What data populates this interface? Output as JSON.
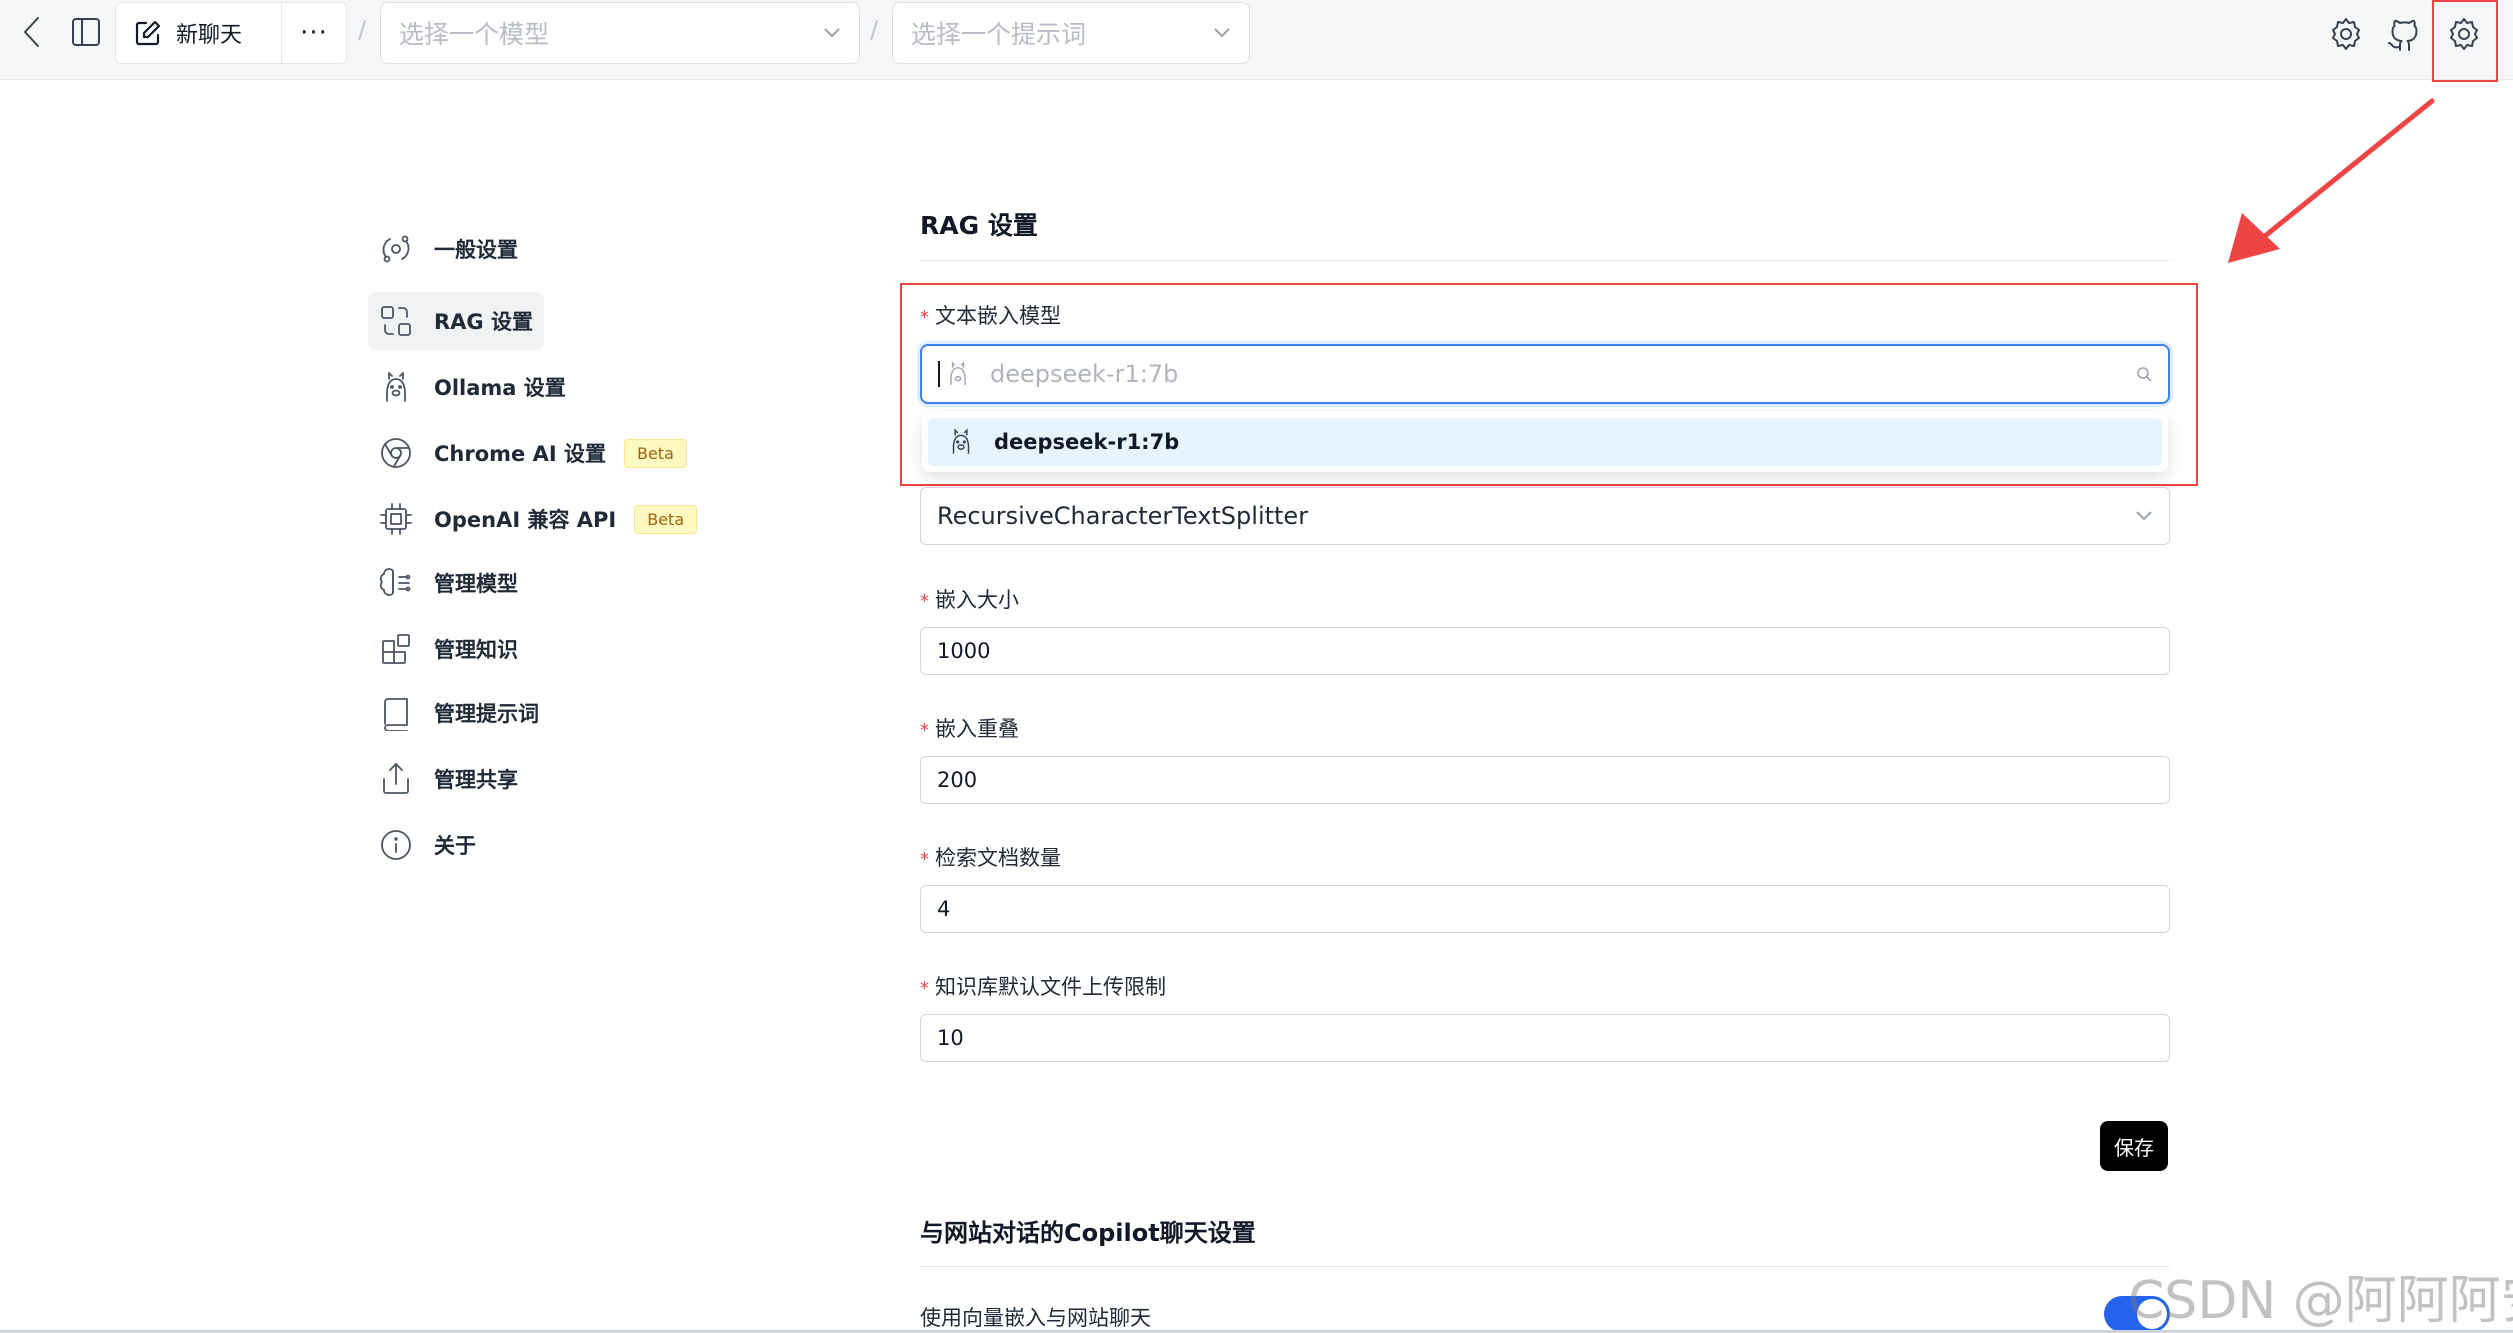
{
  "header": {
    "new_chat_label": "新聊天",
    "more_label": "···",
    "separator": "/",
    "model_select_placeholder": "选择一个模型",
    "prompt_select_placeholder": "选择一个提示词"
  },
  "sidebar": {
    "items": [
      {
        "label": "一般设置",
        "icon": "orbit-icon"
      },
      {
        "label": "RAG 设置",
        "icon": "combine-icon"
      },
      {
        "label": "Ollama 设置",
        "icon": "llama-icon"
      },
      {
        "label": "Chrome AI 设置",
        "icon": "chrome-icon",
        "badge": "Beta"
      },
      {
        "label": "OpenAI 兼容 API",
        "icon": "cpu-icon",
        "badge": "Beta"
      },
      {
        "label": "管理模型",
        "icon": "brain-icon"
      },
      {
        "label": "管理知识",
        "icon": "blocks-icon"
      },
      {
        "label": "管理提示词",
        "icon": "book-icon"
      },
      {
        "label": "管理共享",
        "icon": "share-icon"
      },
      {
        "label": "关于",
        "icon": "info-icon"
      }
    ],
    "active_index": 1
  },
  "rag": {
    "title": "RAG 设置",
    "embedding_model": {
      "label": "文本嵌入模型",
      "search_placeholder": "deepseek-r1:7b",
      "options": [
        "deepseek-r1:7b"
      ]
    },
    "splitter": {
      "value": "RecursiveCharacterTextSplitter"
    },
    "chunk_size": {
      "label": "嵌入大小",
      "value": "1000"
    },
    "chunk_overlap": {
      "label": "嵌入重叠",
      "value": "200"
    },
    "retrieval_docs": {
      "label": "检索文档数量",
      "value": "4"
    },
    "upload_limit": {
      "label": "知识库默认文件上传限制",
      "value": "10"
    },
    "save_label": "保存"
  },
  "copilot": {
    "title": "与网站对话的Copilot聊天设置",
    "vector_embed_label": "使用向量嵌入与网站聊天",
    "vector_embed_enabled": true
  },
  "watermark": "CSDN @阿阿阿安",
  "colors": {
    "accent": "#3b82f6",
    "highlight_red": "#ef4444",
    "option_bg": "#e6f4ff",
    "toggle_on": "#2563eb"
  }
}
